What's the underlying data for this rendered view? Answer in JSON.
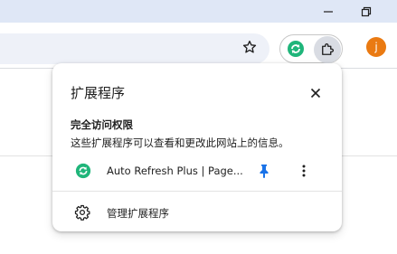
{
  "window_controls": {
    "minimize_icon": "minimize-icon",
    "restore_icon": "restore-icon"
  },
  "toolbar": {
    "star_icon": "star-icon",
    "pinned_extension_icon": "auto-refresh-icon",
    "extensions_icon": "puzzle-icon",
    "avatar_letter": "j",
    "avatar_color": "#ea7a12"
  },
  "popup": {
    "title": "扩展程序",
    "close_icon": "close-icon",
    "section_title": "完全访问权限",
    "section_description": "这些扩展程序可以查看和更改此网站上的信息。",
    "extensions": [
      {
        "name": "Auto Refresh Plus | Page...",
        "icon": "auto-refresh-icon",
        "pin_icon": "pin-icon",
        "pinned": true,
        "more_icon": "more-vert-icon"
      }
    ],
    "manage_label": "管理扩展程序",
    "manage_icon": "gear-icon"
  },
  "colors": {
    "titlebar": "#dfe7f6",
    "accent": "#1a73e8",
    "extension_green": "#1fb57a"
  }
}
